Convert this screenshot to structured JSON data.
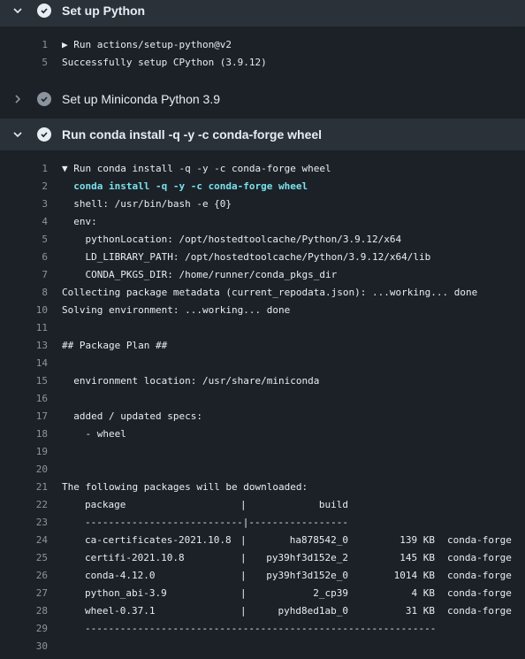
{
  "steps": [
    {
      "title": "Set up Python",
      "state": "expanded"
    },
    {
      "title": "Set up Miniconda Python 3.9",
      "state": "collapsed"
    },
    {
      "title": "Run conda install -q -y -c conda-forge wheel",
      "state": "expanded"
    }
  ],
  "log1": [
    {
      "n": "1",
      "t": "▶ Run actions/setup-python@v2"
    },
    {
      "n": "5",
      "t": "Successfully setup CPython (3.9.12)"
    }
  ],
  "log3": [
    {
      "n": "1",
      "t": "▼ Run conda install -q -y -c conda-forge wheel"
    },
    {
      "n": "2",
      "t": "  conda install -q -y -c conda-forge wheel"
    },
    {
      "n": "3",
      "t": "  shell: /usr/bin/bash -e {0}"
    },
    {
      "n": "4",
      "t": "  env:"
    },
    {
      "n": "5",
      "t": "    pythonLocation: /opt/hostedtoolcache/Python/3.9.12/x64"
    },
    {
      "n": "6",
      "t": "    LD_LIBRARY_PATH: /opt/hostedtoolcache/Python/3.9.12/x64/lib"
    },
    {
      "n": "7",
      "t": "    CONDA_PKGS_DIR: /home/runner/conda_pkgs_dir"
    },
    {
      "n": "8",
      "t": "Collecting package metadata (current_repodata.json): ...working... done"
    },
    {
      "n": "10",
      "t": "Solving environment: ...working... done"
    },
    {
      "n": "11",
      "t": ""
    },
    {
      "n": "13",
      "t": "## Package Plan ##"
    },
    {
      "n": "14",
      "t": ""
    },
    {
      "n": "15",
      "t": "  environment location: /usr/share/miniconda"
    },
    {
      "n": "16",
      "t": ""
    },
    {
      "n": "17",
      "t": "  added / updated specs:"
    },
    {
      "n": "18",
      "t": "    - wheel"
    },
    {
      "n": "19",
      "t": ""
    },
    {
      "n": "20",
      "t": ""
    },
    {
      "n": "21",
      "t": "The following packages will be downloaded:"
    },
    {
      "n": "22",
      "t": ""
    },
    {
      "n": "23",
      "t": ""
    },
    {
      "n": "24",
      "t": ""
    },
    {
      "n": "25",
      "t": ""
    },
    {
      "n": "26",
      "t": ""
    },
    {
      "n": "27",
      "t": ""
    },
    {
      "n": "28",
      "t": ""
    },
    {
      "n": "29",
      "t": ""
    },
    {
      "n": "30",
      "t": ""
    }
  ],
  "pkg_header": {
    "package": "package",
    "build": "build",
    "sep": "|"
  },
  "pkg_rule_top": "---------------------------|-----------------",
  "pkg_rule_bottom": "------------------------------------------------------------",
  "packages": [
    {
      "name": "ca-certificates-2021.10.8",
      "build": "ha878542_0",
      "size": "139 KB",
      "channel": "conda-forge"
    },
    {
      "name": "certifi-2021.10.8",
      "build": "py39hf3d152e_2",
      "size": "145 KB",
      "channel": "conda-forge"
    },
    {
      "name": "conda-4.12.0",
      "build": "py39hf3d152e_0",
      "size": "1014 KB",
      "channel": "conda-forge"
    },
    {
      "name": "python_abi-3.9",
      "build": "2_cp39",
      "size": "4 KB",
      "channel": "conda-forge"
    },
    {
      "name": "wheel-0.37.1",
      "build": "pyhd8ed1ab_0",
      "size": "31 KB",
      "channel": "conda-forge"
    }
  ]
}
